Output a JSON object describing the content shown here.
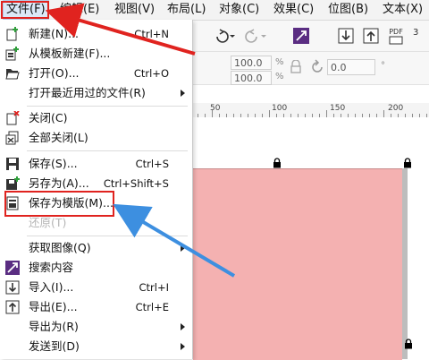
{
  "menubar": {
    "items": [
      {
        "label": "文件(F)",
        "active": true
      },
      {
        "label": "编辑(E)"
      },
      {
        "label": "视图(V)"
      },
      {
        "label": "布局(L)"
      },
      {
        "label": "对象(C)"
      },
      {
        "label": "效果(C)"
      },
      {
        "label": "位图(B)"
      },
      {
        "label": "文本(X)"
      }
    ]
  },
  "toolbar": {
    "pdf_label": "PDF",
    "page_num": "3",
    "scale_x": "100.0",
    "scale_y": "100.0",
    "percent": "%",
    "angle": "0.0",
    "angle_unit": "°"
  },
  "ruler": {
    "labels": [
      "50",
      "100",
      "150",
      "200"
    ]
  },
  "file_menu": {
    "items": [
      {
        "label": "新建(N)...",
        "shortcut": "Ctrl+N",
        "icon": "new-document-icon"
      },
      {
        "label": "从模板新建(F)...",
        "shortcut": "",
        "icon": "new-from-template-icon"
      },
      {
        "label": "打开(O)...",
        "shortcut": "Ctrl+O",
        "icon": "folder-open-icon"
      },
      {
        "label": "打开最近用过的文件(R)",
        "shortcut": "",
        "submenu": true
      },
      {
        "label": "关闭(C)",
        "shortcut": "",
        "icon": "close-document-icon"
      },
      {
        "label": "全部关闭(L)",
        "shortcut": "",
        "icon": "close-all-icon"
      },
      {
        "label": "保存(S)...",
        "shortcut": "Ctrl+S",
        "icon": "save-icon"
      },
      {
        "label": "另存为(A)...",
        "shortcut": "Ctrl+Shift+S",
        "icon": "save-as-icon"
      },
      {
        "label": "保存为模版(M)...",
        "shortcut": "",
        "icon": "save-as-template-icon",
        "highlighted": true
      },
      {
        "label": "还原(T)",
        "shortcut": "",
        "disabled": true
      },
      {
        "label": "获取图像(Q)",
        "shortcut": "",
        "submenu": true
      },
      {
        "label": "搜索内容",
        "shortcut": "",
        "icon": "search-content-icon"
      },
      {
        "label": "导入(I)...",
        "shortcut": "Ctrl+I",
        "icon": "import-icon"
      },
      {
        "label": "导出(E)...",
        "shortcut": "Ctrl+E",
        "icon": "export-icon"
      },
      {
        "label": "导出为(R)",
        "shortcut": "",
        "submenu": true
      },
      {
        "label": "发送到(D)",
        "shortcut": "",
        "submenu": true
      }
    ]
  },
  "colors": {
    "highlight_red": "#e0231f",
    "arrow_blue": "#3d8fe0",
    "page_pink": "#f4b1b1",
    "menu_active": "#dbe8f7"
  }
}
